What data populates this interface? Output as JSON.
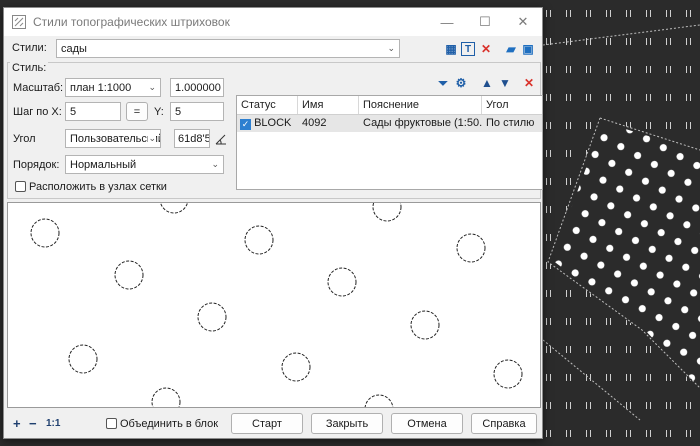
{
  "window": {
    "title": "Стили топографических штриховок",
    "minimize": "—",
    "maximize": "☐",
    "close": "✕"
  },
  "styles": {
    "label": "Стили:",
    "value": "сады"
  },
  "style_group": {
    "label": "Стиль:",
    "scale_label": "Масштаб:",
    "scale_value": "план 1:1000",
    "scale_factor": "1.000000",
    "stepx_label": "Шаг по X:",
    "stepx_value": "5",
    "equal_label": "=",
    "y_label": "Y:",
    "y_value": "5",
    "angle_label": "Угол",
    "angle_mode": "Пользовательский",
    "angle_value": "61d8'5",
    "order_label": "Порядок:",
    "order_value": "Нормальный",
    "grid_nodes_label": "Расположить в узлах сетки"
  },
  "table": {
    "columns": [
      "Статус",
      "Имя",
      "Пояснение",
      "Угол"
    ],
    "rows": [
      {
        "status": "BLOCK",
        "name": "4092",
        "description": "Сады фруктовые (1:50...",
        "angle": "По стилю"
      }
    ]
  },
  "bottom": {
    "zoom_in": "+",
    "zoom_out": "−",
    "zoom_reset": "1:1",
    "merge_label": "Объединить в блок",
    "start": "Старт",
    "close": "Закрыть",
    "cancel": "Отмена",
    "help": "Справка"
  }
}
